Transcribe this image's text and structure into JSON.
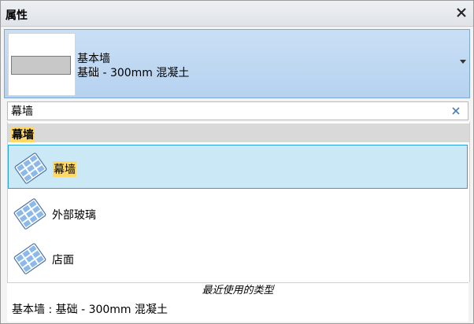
{
  "panel": {
    "title": "属性",
    "close_icon": "close-icon"
  },
  "type_selector": {
    "family": "基本墙",
    "type": "基础 - 300mm 混凝土",
    "arrow_icon": "dropdown-arrow-icon"
  },
  "search": {
    "value": "幕墙",
    "clear_icon": "clear-icon"
  },
  "results": {
    "group_label": "幕墙",
    "items": [
      {
        "label": "幕墙",
        "icon": "curtain-wall-icon",
        "selected": true
      },
      {
        "label": "外部玻璃",
        "icon": "curtain-wall-icon",
        "selected": false
      },
      {
        "label": "店面",
        "icon": "curtain-wall-icon",
        "selected": false
      }
    ]
  },
  "recent": {
    "section_label": "最近使用的类型",
    "items": [
      "基本墙 : 基础 - 300mm 混凝土"
    ]
  },
  "colors": {
    "highlight": "#ffd966",
    "selection": "#cbe8f6",
    "selection_border": "#26a0da"
  }
}
